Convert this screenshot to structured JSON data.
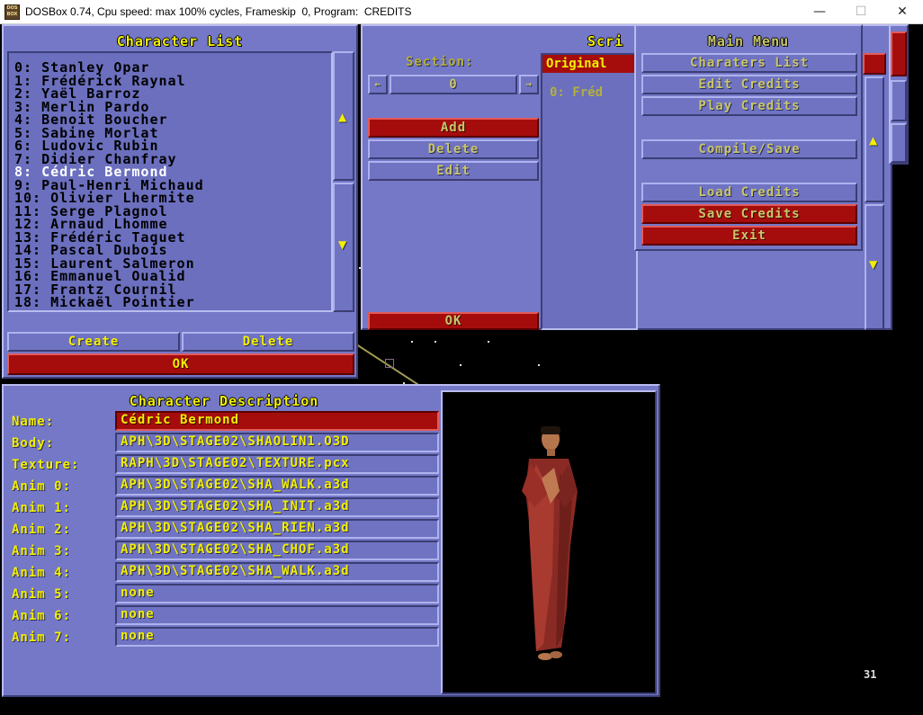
{
  "window": {
    "title": "DOSBox 0.74, Cpu speed: max 100% cycles, Frameskip  0, Program:  CREDITS",
    "icon_text": "DOS BOX",
    "minimize": "—",
    "maximize": "☐",
    "close": "✕"
  },
  "character_list": {
    "title": "Character List",
    "items": [
      "0: Stanley Opar",
      "1: Frédérick Raynal",
      "2: Yaël Barroz",
      "3: Merlin Pardo",
      "4: Benoit Boucher",
      "5: Sabine Morlat",
      "6: Ludovic Rubin",
      "7: Didier Chanfray",
      "8: Cédric Bermond",
      "9: Paul-Henri Michaud",
      "10: Olivier Lhermite",
      "11: Serge Plagnol",
      "12: Arnaud Lhomme",
      "13: Frédéric Taquet",
      "14: Pascal Dubois",
      "15: Laurent Salmeron",
      "16: Emmanuel Oualid",
      "17: Frantz Cournil",
      "18: Mickaël Pointier"
    ],
    "selected_index": 8,
    "scroll_up": "▲",
    "scroll_down": "▼",
    "create": "Create",
    "delete": "Delete",
    "ok": "OK"
  },
  "script_panel": {
    "title_partial": "Scri",
    "section_label": "Section:",
    "section_value": "0",
    "dec": "←",
    "inc": "→",
    "add": "Add",
    "delete": "Delete",
    "edit": "Edit",
    "ok": "OK",
    "list_header": "Original",
    "list_item": "0: Fréd",
    "scroll_up": "▲",
    "scroll_down": "▼"
  },
  "main_menu": {
    "title": "Main Menu",
    "items": {
      "characters_list": "Charaters List",
      "edit_credits": "Edit Credits",
      "play_credits": "Play Credits",
      "compile_save": "Compile/Save",
      "load_credits": "Load Credits",
      "save_credits": "Save Credits",
      "exit": "Exit"
    }
  },
  "character_description": {
    "title": "Character Description",
    "labels": {
      "name": "Name:",
      "body": "Body:",
      "texture": "Texture:",
      "anim0": "Anim 0:",
      "anim1": "Anim 1:",
      "anim2": "Anim 2:",
      "anim3": "Anim 3:",
      "anim4": "Anim 4:",
      "anim5": "Anim 5:",
      "anim6": "Anim 6:",
      "anim7": "Anim 7:"
    },
    "values": {
      "name": "Cédric Bermond",
      "body": "APH\\3D\\STAGE02\\SHAOLIN1.O3D",
      "texture": "RAPH\\3D\\STAGE02\\TEXTURE.pcx",
      "anim0": "APH\\3D\\STAGE02\\SHA_WALK.a3d",
      "anim1": "APH\\3D\\STAGE02\\SHA_INIT.a3d",
      "anim2": "APH\\3D\\STAGE02\\SHA_RIEN.a3d",
      "anim3": "APH\\3D\\STAGE02\\SHA_CHOF.a3d",
      "anim4": "APH\\3D\\STAGE02\\SHA_WALK.a3d",
      "anim5": "none",
      "anim6": "none",
      "anim7": "none"
    }
  },
  "fps_counter": "31",
  "colors": {
    "panel": "#7478c6",
    "text_yellow": "#f2ef00",
    "button_red": "#a50d0d"
  }
}
